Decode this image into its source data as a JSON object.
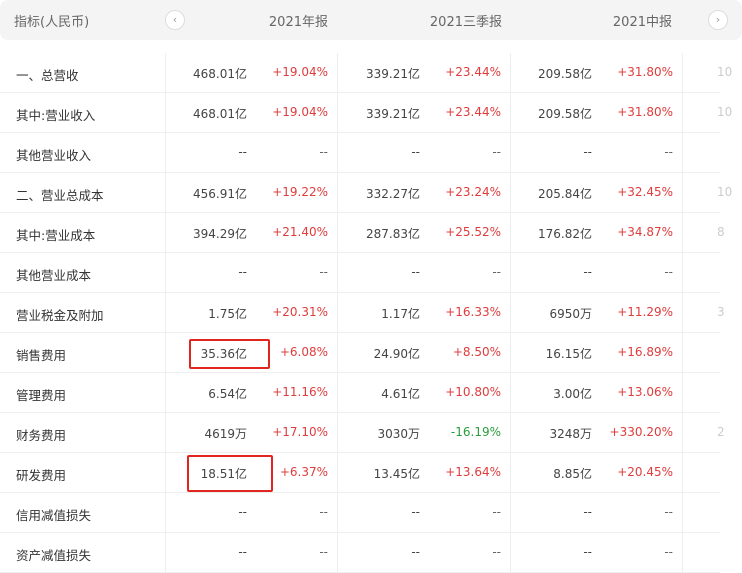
{
  "header": {
    "label": "指标(人民币)",
    "periods": [
      "2021年报",
      "2021三季报",
      "2021中报"
    ],
    "prev_icon": "chevron-left-icon",
    "next_icon": "chevron-right-icon"
  },
  "colors": {
    "up": "#e03c3c",
    "down": "#2a9d3c",
    "highlight": "#e0261e"
  },
  "rows": [
    {
      "name": "一、总营收",
      "c": [
        [
          "468.01亿",
          "+19.04%",
          "up"
        ],
        [
          "339.21亿",
          "+23.44%",
          "up"
        ],
        [
          "209.58亿",
          "+31.80%",
          "up"
        ]
      ],
      "partial": "10"
    },
    {
      "name": "其中:营业收入",
      "c": [
        [
          "468.01亿",
          "+19.04%",
          "up"
        ],
        [
          "339.21亿",
          "+23.44%",
          "up"
        ],
        [
          "209.58亿",
          "+31.80%",
          "up"
        ]
      ],
      "partial": "10"
    },
    {
      "name": "其他营业收入",
      "c": [
        [
          "--",
          "--",
          "na"
        ],
        [
          "--",
          "--",
          "na"
        ],
        [
          "--",
          "--",
          "na"
        ]
      ],
      "partial": ""
    },
    {
      "name": "二、营业总成本",
      "c": [
        [
          "456.91亿",
          "+19.22%",
          "up"
        ],
        [
          "332.27亿",
          "+23.24%",
          "up"
        ],
        [
          "205.84亿",
          "+32.45%",
          "up"
        ]
      ],
      "partial": "10"
    },
    {
      "name": "其中:营业成本",
      "c": [
        [
          "394.29亿",
          "+21.40%",
          "up"
        ],
        [
          "287.83亿",
          "+25.52%",
          "up"
        ],
        [
          "176.82亿",
          "+34.87%",
          "up"
        ]
      ],
      "partial": "8"
    },
    {
      "name": "其他营业成本",
      "c": [
        [
          "--",
          "--",
          "na"
        ],
        [
          "--",
          "--",
          "na"
        ],
        [
          "--",
          "--",
          "na"
        ]
      ],
      "partial": ""
    },
    {
      "name": "营业税金及附加",
      "c": [
        [
          "1.75亿",
          "+20.31%",
          "up"
        ],
        [
          "1.17亿",
          "+16.33%",
          "up"
        ],
        [
          "6950万",
          "+11.29%",
          "up"
        ]
      ],
      "partial": "3"
    },
    {
      "name": "销售费用",
      "c": [
        [
          "35.36亿",
          "+6.08%",
          "up"
        ],
        [
          "24.90亿",
          "+8.50%",
          "up"
        ],
        [
          "16.15亿",
          "+16.89%",
          "up"
        ]
      ],
      "partial": ""
    },
    {
      "name": "管理费用",
      "c": [
        [
          "6.54亿",
          "+11.16%",
          "up"
        ],
        [
          "4.61亿",
          "+10.80%",
          "up"
        ],
        [
          "3.00亿",
          "+13.06%",
          "up"
        ]
      ],
      "partial": ""
    },
    {
      "name": "财务费用",
      "c": [
        [
          "4619万",
          "+17.10%",
          "up"
        ],
        [
          "3030万",
          "-16.19%",
          "dn"
        ],
        [
          "3248万",
          "+330.20%",
          "up"
        ]
      ],
      "partial": "2"
    },
    {
      "name": "研发费用",
      "c": [
        [
          "18.51亿",
          "+6.37%",
          "up"
        ],
        [
          "13.45亿",
          "+13.64%",
          "up"
        ],
        [
          "8.85亿",
          "+20.45%",
          "up"
        ]
      ],
      "partial": ""
    },
    {
      "name": "信用减值损失",
      "c": [
        [
          "--",
          "--",
          "na"
        ],
        [
          "--",
          "--",
          "na"
        ],
        [
          "--",
          "--",
          "na"
        ]
      ],
      "partial": ""
    },
    {
      "name": "资产减值损失",
      "c": [
        [
          "--",
          "--",
          "na"
        ],
        [
          "--",
          "--",
          "na"
        ],
        [
          "--",
          "--",
          "na"
        ]
      ],
      "partial": ""
    }
  ]
}
